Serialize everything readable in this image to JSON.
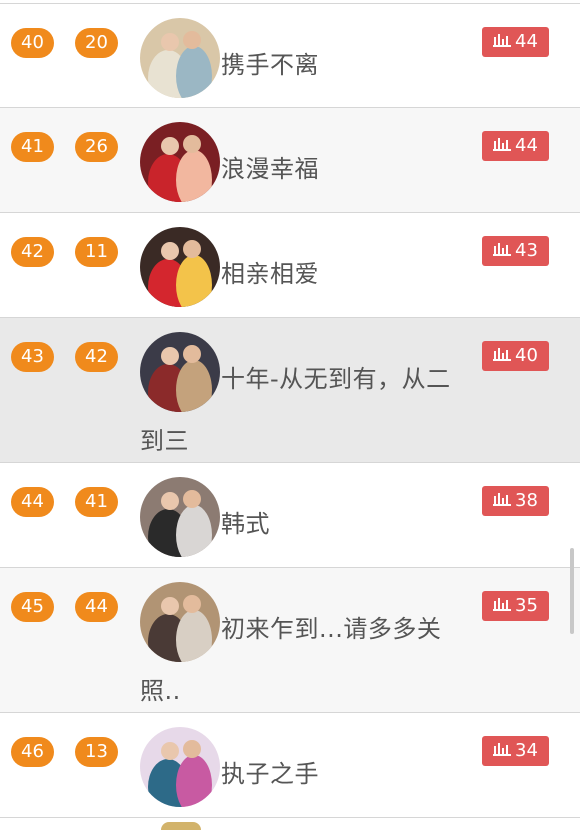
{
  "rows": [
    {
      "rank": "40",
      "num": "20",
      "title": "携手不离",
      "votes": "44",
      "theme": "white",
      "palette": [
        "#e8e2d2",
        "#9bb7c4",
        "#d9c7a8"
      ]
    },
    {
      "rank": "41",
      "num": "26",
      "title": "浪漫幸福",
      "votes": "44",
      "theme": "alt",
      "palette": [
        "#c9242b",
        "#f2b79f",
        "#7a1f23"
      ]
    },
    {
      "rank": "42",
      "num": "11",
      "title": "相亲相爱",
      "votes": "43",
      "theme": "white",
      "palette": [
        "#d4262e",
        "#f3c34a",
        "#3a2a25"
      ]
    },
    {
      "rank": "43",
      "num": "42",
      "title": "十年-从无到有，从二到三",
      "votes": "40",
      "theme": "sel",
      "palette": [
        "#8b2a2a",
        "#c4a27c",
        "#3b3b48"
      ]
    },
    {
      "rank": "44",
      "num": "41",
      "title": "韩式",
      "votes": "38",
      "theme": "white",
      "palette": [
        "#2a2a2a",
        "#d9d6d4",
        "#8c7b72"
      ]
    },
    {
      "rank": "45",
      "num": "44",
      "title": "初来乍到...请多多关照..",
      "votes": "35",
      "theme": "alt",
      "palette": [
        "#4a3a36",
        "#d8cfc4",
        "#b19474"
      ]
    },
    {
      "rank": "46",
      "num": "13",
      "title": "执子之手",
      "votes": "34",
      "theme": "white",
      "palette": [
        "#2d6a88",
        "#c85aa2",
        "#e7d9e9"
      ]
    }
  ],
  "colors": {
    "pill_orange": "#f08a1c",
    "vote_red": "#e05656",
    "text_gray": "#555555"
  },
  "icons": {
    "vote_icon": "bar-chart-icon"
  }
}
